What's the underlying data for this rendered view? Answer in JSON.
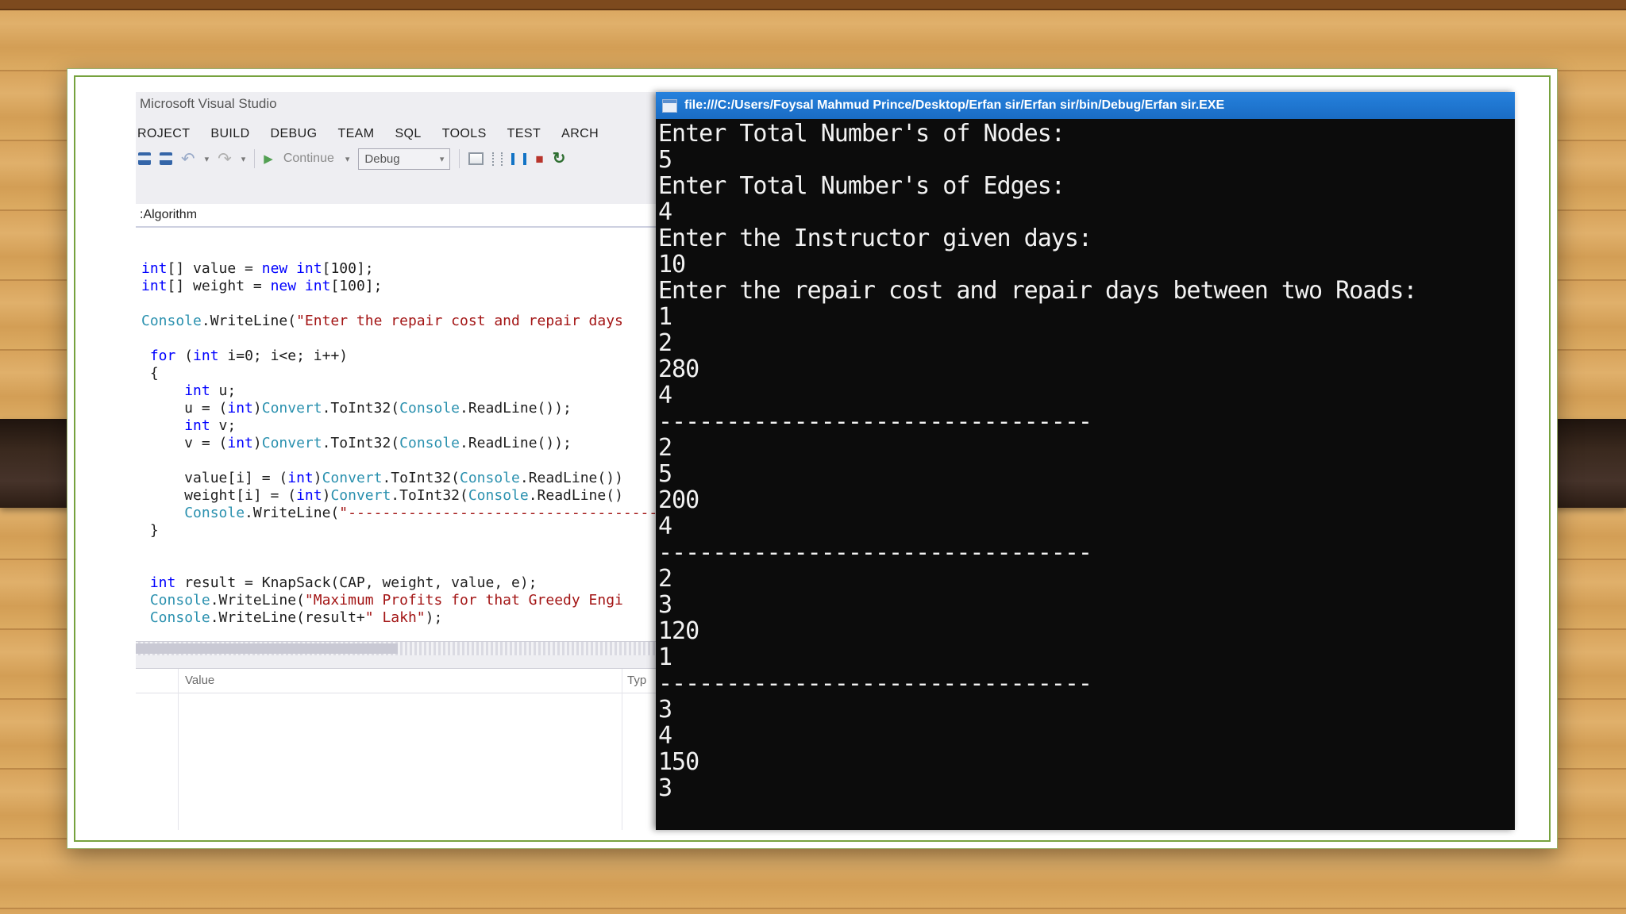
{
  "colors": {
    "slide_border_green": "#76a23e",
    "console_titlebar_blue": "#1c75d0",
    "desk_band_brown": "#3a291e",
    "wood_tan": "#d9a95f",
    "syntax_keyword": "#0000ff",
    "syntax_type": "#2b91af",
    "syntax_string": "#a31515"
  },
  "icons": {
    "undo": "↶",
    "redo": "↷",
    "caret": "▾",
    "play": "▶",
    "stop": "■",
    "restart": "↻"
  },
  "vs": {
    "window_title": "Microsoft Visual Studio",
    "menu_items": [
      "ROJECT",
      "BUILD",
      "DEBUG",
      "TEAM",
      "SQL",
      "TOOLS",
      "TEST",
      "ARCH"
    ],
    "toolbar": {
      "continue_label": "Continue",
      "debug_combo_value": "Debug"
    },
    "breadcrumb": ":Algorithm",
    "editor": {
      "code_lines": [
        [
          [
            "k",
            "int"
          ],
          [
            "p",
            "[] value = "
          ],
          [
            "k",
            "new"
          ],
          [
            "p",
            " "
          ],
          [
            "k",
            "int"
          ],
          [
            "p",
            "[100];"
          ]
        ],
        [
          [
            "k",
            "int"
          ],
          [
            "p",
            "[] weight = "
          ],
          [
            "k",
            "new"
          ],
          [
            "p",
            " "
          ],
          [
            "k",
            "int"
          ],
          [
            "p",
            "[100];"
          ]
        ],
        [],
        [
          [
            "t",
            "Console"
          ],
          [
            "p",
            ".WriteLine("
          ],
          [
            "s",
            "\"Enter the repair cost and repair days"
          ]
        ],
        [],
        [
          [
            "p",
            " "
          ],
          [
            "k",
            "for"
          ],
          [
            "p",
            " ("
          ],
          [
            "k",
            "int"
          ],
          [
            "p",
            " i=0; i<e; i++)"
          ]
        ],
        [
          [
            "p",
            " {"
          ]
        ],
        [
          [
            "p",
            "     "
          ],
          [
            "k",
            "int"
          ],
          [
            "p",
            " u;"
          ]
        ],
        [
          [
            "p",
            "     u = ("
          ],
          [
            "k",
            "int"
          ],
          [
            "p",
            ")"
          ],
          [
            "t",
            "Convert"
          ],
          [
            "p",
            ".ToInt32("
          ],
          [
            "t",
            "Console"
          ],
          [
            "p",
            ".ReadLine());"
          ]
        ],
        [
          [
            "p",
            "     "
          ],
          [
            "k",
            "int"
          ],
          [
            "p",
            " v;"
          ]
        ],
        [
          [
            "p",
            "     v = ("
          ],
          [
            "k",
            "int"
          ],
          [
            "p",
            ")"
          ],
          [
            "t",
            "Convert"
          ],
          [
            "p",
            ".ToInt32("
          ],
          [
            "t",
            "Console"
          ],
          [
            "p",
            ".ReadLine());"
          ]
        ],
        [],
        [
          [
            "p",
            "     value[i] = ("
          ],
          [
            "k",
            "int"
          ],
          [
            "p",
            ")"
          ],
          [
            "t",
            "Convert"
          ],
          [
            "p",
            ".ToInt32("
          ],
          [
            "t",
            "Console"
          ],
          [
            "p",
            ".ReadLine())"
          ]
        ],
        [
          [
            "p",
            "     weight[i] = ("
          ],
          [
            "k",
            "int"
          ],
          [
            "p",
            ")"
          ],
          [
            "t",
            "Convert"
          ],
          [
            "p",
            ".ToInt32("
          ],
          [
            "t",
            "Console"
          ],
          [
            "p",
            ".ReadLine()"
          ]
        ],
        [
          [
            "p",
            "     "
          ],
          [
            "t",
            "Console"
          ],
          [
            "p",
            ".WriteLine("
          ],
          [
            "s",
            "\"----------------------------------------"
          ]
        ],
        [
          [
            "p",
            " }"
          ]
        ],
        [],
        [],
        [
          [
            "p",
            " "
          ],
          [
            "k",
            "int"
          ],
          [
            "p",
            " result = KnapSack(CAP, weight, value, e);"
          ]
        ],
        [
          [
            "p",
            " "
          ],
          [
            "t",
            "Console"
          ],
          [
            "p",
            ".WriteLine("
          ],
          [
            "s",
            "\"Maximum Profits for that Greedy Engi"
          ]
        ],
        [
          [
            "p",
            " "
          ],
          [
            "t",
            "Console"
          ],
          [
            "p",
            ".WriteLine(result+"
          ],
          [
            "s",
            "\" Lakh\""
          ],
          [
            "p",
            ");"
          ]
        ]
      ]
    },
    "locals_panel": {
      "value_header": "Value",
      "type_header": "Typ"
    }
  },
  "console": {
    "title": "file:///C:/Users/Foysal Mahmud Prince/Desktop/Erfan sir/Erfan sir/bin/Debug/Erfan sir.EXE",
    "lines": [
      "Enter Total Number's of Nodes:",
      "5",
      "Enter Total Number's of Edges:",
      "4",
      "Enter the Instructor given days:",
      "10",
      "Enter the repair cost and repair days between two Roads:",
      "1",
      "2",
      "280",
      "4",
      "--------------------------------",
      "2",
      "5",
      "200",
      "4",
      "--------------------------------",
      "2",
      "3",
      "120",
      "1",
      "--------------------------------",
      "3",
      "4",
      "150",
      "3"
    ]
  }
}
